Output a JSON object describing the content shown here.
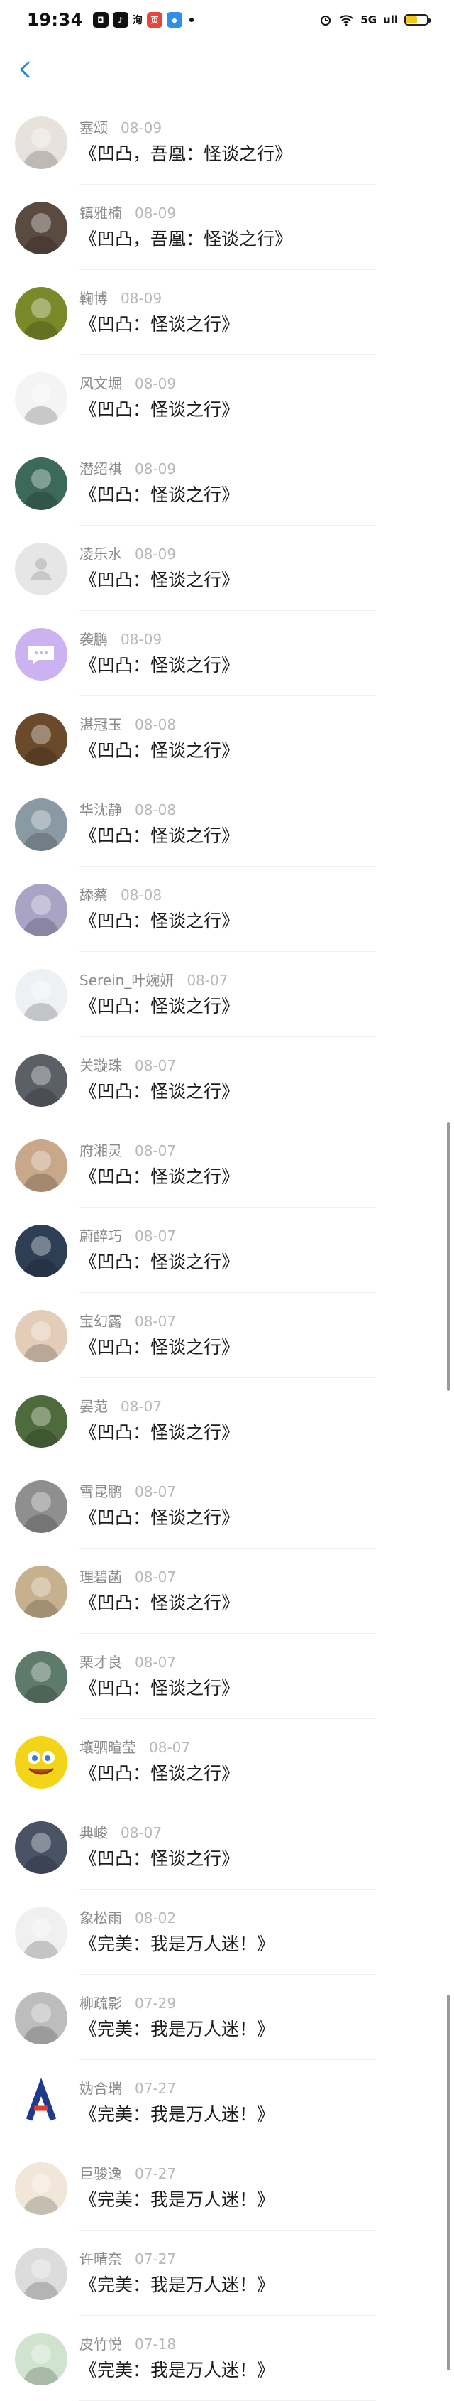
{
  "status_bar": {
    "time": "19:34",
    "notification_icons": [
      "app-notification-icon",
      "tiktok-icon",
      "text-badge-icon",
      "news-icon",
      "cloud-app-icon"
    ],
    "text_badge": "洵",
    "news_badge": "页",
    "system": {
      "network": "5G",
      "signal": "ull"
    }
  },
  "nav": {
    "back_icon": "chevron-left-icon",
    "accent": "#1e88e5"
  },
  "avatar_colors": [
    "#e8e2dc",
    "#5a4a40",
    "#7a8a2a",
    "#f4f4f4",
    "#3c6a5a",
    "#e6e6e6",
    "#cbb3f2",
    "#6a4a2a",
    "#8a9aa4",
    "#a9a3c6",
    "#eef1f4",
    "#5b5f66",
    "#c9a88a",
    "#2e3f55",
    "#e3cdb8",
    "#4d6b3c",
    "#8f8f8f",
    "#c7b08d",
    "#5e7a6a",
    "#f2d418",
    "#4a5266",
    "#f0f0f0",
    "#bdbdbd",
    "#ffffff",
    "#f1e7d8",
    "#dcdcdc",
    "#cfe3cf"
  ],
  "rows": [
    {
      "name": "塞颂",
      "date": "08-09",
      "title": "《凹凸，吾凰：怪谈之行》",
      "avatar_icon": "avatar-image-icon"
    },
    {
      "name": "镇雅楠",
      "date": "08-09",
      "title": "《凹凸，吾凰：怪谈之行》",
      "avatar_icon": "avatar-image-icon"
    },
    {
      "name": "鞠博",
      "date": "08-09",
      "title": "《凹凸：怪谈之行》",
      "avatar_icon": "avatar-image-icon"
    },
    {
      "name": "风文堀",
      "date": "08-09",
      "title": "《凹凸：怪谈之行》",
      "avatar_icon": "avatar-image-icon"
    },
    {
      "name": "潜绍祺",
      "date": "08-09",
      "title": "《凹凸：怪谈之行》",
      "avatar_icon": "avatar-image-icon"
    },
    {
      "name": "凌乐水",
      "date": "08-09",
      "title": "《凹凸：怪谈之行》",
      "avatar_icon": "default-avatar-icon"
    },
    {
      "name": "袭鹏",
      "date": "08-09",
      "title": "《凹凸：怪谈之行》",
      "avatar_icon": "chat-bubble-avatar-icon"
    },
    {
      "name": "湛冠玉",
      "date": "08-08",
      "title": "《凹凸：怪谈之行》",
      "avatar_icon": "avatar-image-icon"
    },
    {
      "name": "华沈静",
      "date": "08-08",
      "title": "《凹凸：怪谈之行》",
      "avatar_icon": "avatar-image-icon"
    },
    {
      "name": "舔蔡",
      "date": "08-08",
      "title": "《凹凸：怪谈之行》",
      "avatar_icon": "avatar-image-icon"
    },
    {
      "name": "Serein_叶婉妍",
      "date": "08-07",
      "title": "《凹凸：怪谈之行》",
      "avatar_icon": "avatar-image-icon"
    },
    {
      "name": "关璇珠",
      "date": "08-07",
      "title": "《凹凸：怪谈之行》",
      "avatar_icon": "avatar-image-icon"
    },
    {
      "name": "府湘灵",
      "date": "08-07",
      "title": "《凹凸：怪谈之行》",
      "avatar_icon": "avatar-image-icon"
    },
    {
      "name": "蔚醉巧",
      "date": "08-07",
      "title": "《凹凸：怪谈之行》",
      "avatar_icon": "avatar-image-icon"
    },
    {
      "name": "宝幻露",
      "date": "08-07",
      "title": "《凹凸：怪谈之行》",
      "avatar_icon": "avatar-image-icon"
    },
    {
      "name": "晏范",
      "date": "08-07",
      "title": "《凹凸：怪谈之行》",
      "avatar_icon": "avatar-image-icon"
    },
    {
      "name": "雪昆鹏",
      "date": "08-07",
      "title": "《凹凸：怪谈之行》",
      "avatar_icon": "avatar-image-icon"
    },
    {
      "name": "理碧菡",
      "date": "08-07",
      "title": "《凹凸：怪谈之行》",
      "avatar_icon": "avatar-image-icon"
    },
    {
      "name": "栗才良",
      "date": "08-07",
      "title": "《凹凸：怪谈之行》",
      "avatar_icon": "avatar-image-icon"
    },
    {
      "name": "壤驷暄莹",
      "date": "08-07",
      "title": "《凹凸：怪谈之行》",
      "avatar_icon": "sponge-avatar-icon"
    },
    {
      "name": "典峻",
      "date": "08-07",
      "title": "《凹凸：怪谈之行》",
      "avatar_icon": "avatar-image-icon"
    },
    {
      "name": "象松雨",
      "date": "08-02",
      "title": "《完美：我是万人迷！》",
      "avatar_icon": "avatar-image-icon"
    },
    {
      "name": "柳疏影",
      "date": "07-29",
      "title": "《完美：我是万人迷！》",
      "avatar_icon": "avatar-image-icon"
    },
    {
      "name": "妫合瑞",
      "date": "07-27",
      "title": "《完美：我是万人迷！》",
      "avatar_icon": "letter-a-avatar-icon"
    },
    {
      "name": "巨骏逸",
      "date": "07-27",
      "title": "《完美：我是万人迷！》",
      "avatar_icon": "avatar-image-icon"
    },
    {
      "name": "许晴奈",
      "date": "07-27",
      "title": "《完美：我是万人迷！》",
      "avatar_icon": "avatar-image-icon"
    },
    {
      "name": "皮竹悦",
      "date": "07-18",
      "title": "《完美：我是万人迷！》",
      "avatar_icon": "avatar-image-icon"
    }
  ]
}
